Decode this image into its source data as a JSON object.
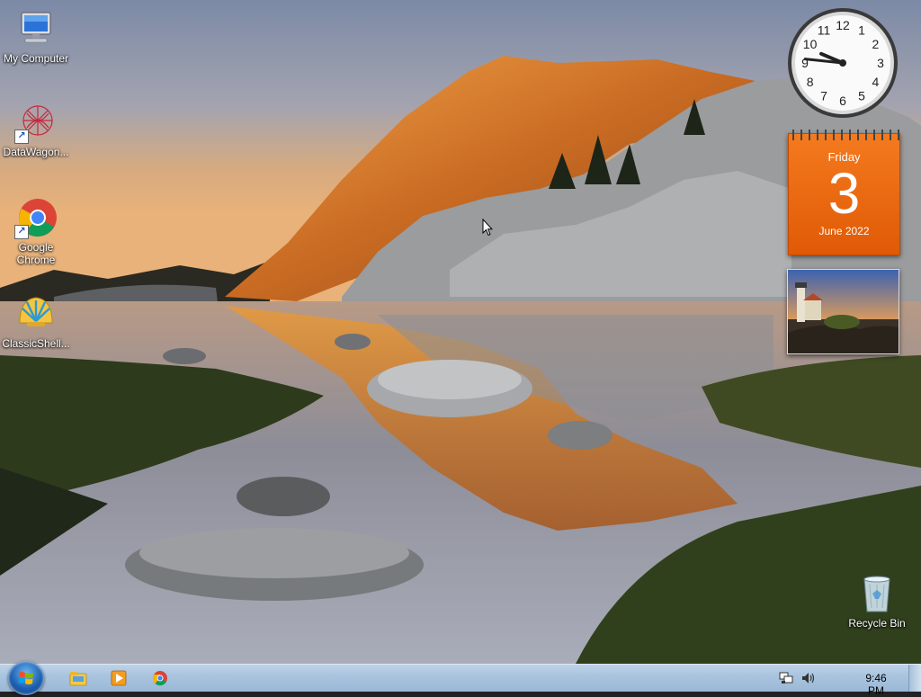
{
  "desktop": {
    "icons": [
      {
        "label": "My Computer",
        "icon": "computer-icon"
      },
      {
        "label": "DataWagon...",
        "icon": "datawagon-icon",
        "shortcut": true
      },
      {
        "label": "Google Chrome",
        "icon": "chrome-icon",
        "shortcut": true
      },
      {
        "label": "ClassicShell...",
        "icon": "classicshell-icon"
      },
      {
        "label": "Recycle Bin",
        "icon": "recycle-bin-icon"
      }
    ]
  },
  "gadgets": {
    "clock": {
      "numerals": [
        "12",
        "1",
        "2",
        "3",
        "4",
        "5",
        "6",
        "7",
        "8",
        "9",
        "10",
        "11"
      ],
      "hour": 9,
      "minute": 46
    },
    "calendar": {
      "day": "Friday",
      "date": "3",
      "month": "June 2022"
    },
    "slideshow": {
      "subject": "lighthouse-photo"
    }
  },
  "taskbar": {
    "pinned": [
      "explorer-icon",
      "media-player-icon",
      "chrome-icon"
    ],
    "tray": [
      "network-icon",
      "volume-icon"
    ],
    "time": "9:46 PM"
  },
  "colors": {
    "calendar_orange": "#f06a10",
    "taskbar_blue": "#a8c3de",
    "start_orb": "#1b5fb1"
  }
}
